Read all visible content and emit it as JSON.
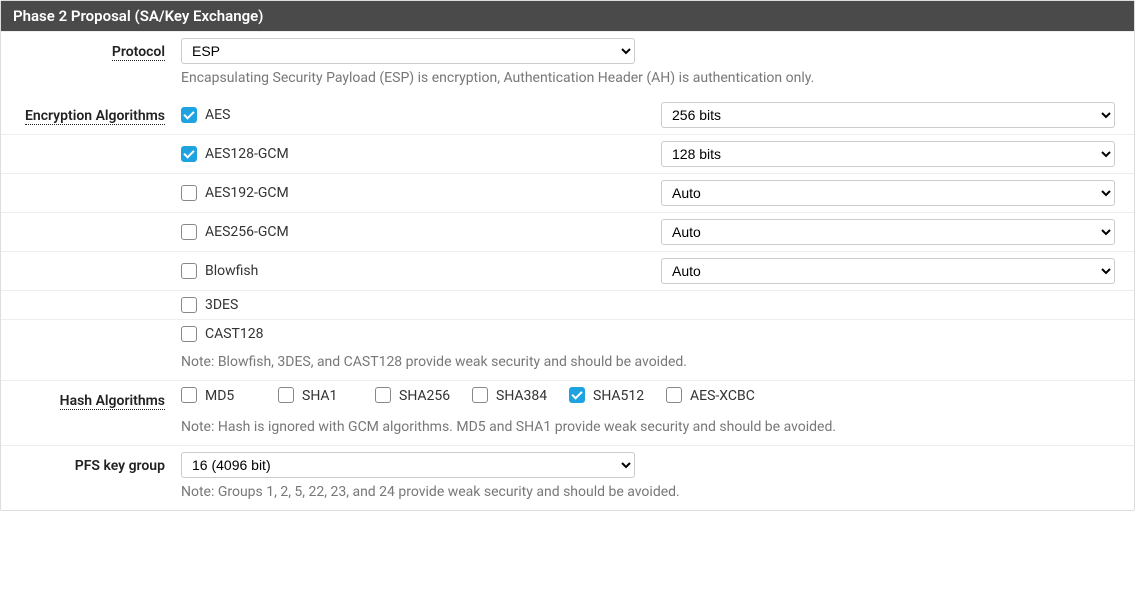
{
  "panel": {
    "title": "Phase 2 Proposal (SA/Key Exchange)"
  },
  "protocol": {
    "label": "Protocol",
    "value": "ESP",
    "help": "Encapsulating Security Payload (ESP) is encryption, Authentication Header (AH) is authentication only."
  },
  "encryption": {
    "label": "Encryption Algorithms",
    "items": [
      {
        "name": "AES",
        "checked": true,
        "select": "256 bits"
      },
      {
        "name": "AES128-GCM",
        "checked": true,
        "select": "128 bits"
      },
      {
        "name": "AES192-GCM",
        "checked": false,
        "select": "Auto"
      },
      {
        "name": "AES256-GCM",
        "checked": false,
        "select": "Auto"
      },
      {
        "name": "Blowfish",
        "checked": false,
        "select": "Auto"
      },
      {
        "name": "3DES",
        "checked": false,
        "select": null
      },
      {
        "name": "CAST128",
        "checked": false,
        "select": null
      }
    ],
    "note": "Note: Blowfish, 3DES, and CAST128 provide weak security and should be avoided."
  },
  "hash": {
    "label": "Hash Algorithms",
    "items": [
      {
        "name": "MD5",
        "checked": false
      },
      {
        "name": "SHA1",
        "checked": false
      },
      {
        "name": "SHA256",
        "checked": false
      },
      {
        "name": "SHA384",
        "checked": false
      },
      {
        "name": "SHA512",
        "checked": true
      },
      {
        "name": "AES-XCBC",
        "checked": false
      }
    ],
    "note": "Note: Hash is ignored with GCM algorithms. MD5 and SHA1 provide weak security and should be avoided."
  },
  "pfs": {
    "label": "PFS key group",
    "value": "16 (4096 bit)",
    "note": "Note: Groups 1, 2, 5, 22, 23, and 24 provide weak security and should be avoided."
  }
}
